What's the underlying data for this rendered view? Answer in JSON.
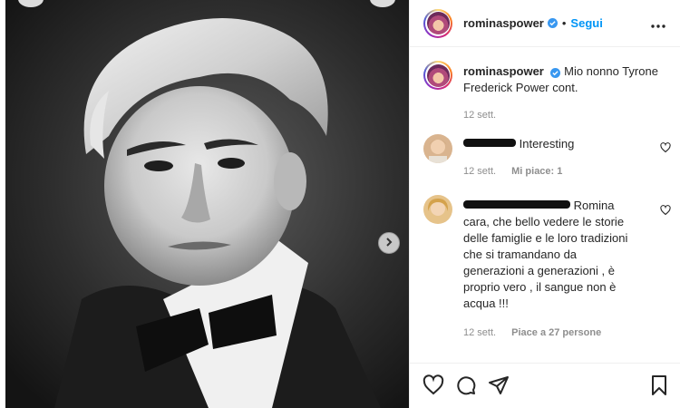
{
  "post": {
    "author": "rominaspower",
    "follow_label": "Segui",
    "separator": "•",
    "caption": "Mio nonno Tyrone Frederick Power cont.",
    "caption_time": "12 sett."
  },
  "comments": [
    {
      "text": "Interesting",
      "time": "12 sett.",
      "likes": "Mi piace: 1"
    },
    {
      "text": "Romina cara, che bello vedere le storie delle famiglie e le loro tradizioni che si tramandano da generazioni a generazioni , è proprio vero , il sangue non è acqua !!!",
      "time": "12 sett.",
      "likes": "Piace a 27 persone"
    }
  ],
  "icons": {
    "like": "heart-icon",
    "comment": "comment-icon",
    "share": "send-icon",
    "save": "bookmark-icon",
    "more": "more-options-icon",
    "next": "chevron-right-icon",
    "verified": "verified-badge-icon"
  },
  "colors": {
    "accent": "#0095f6",
    "verified": "#3897f0",
    "muted": "#8e8e8e"
  }
}
